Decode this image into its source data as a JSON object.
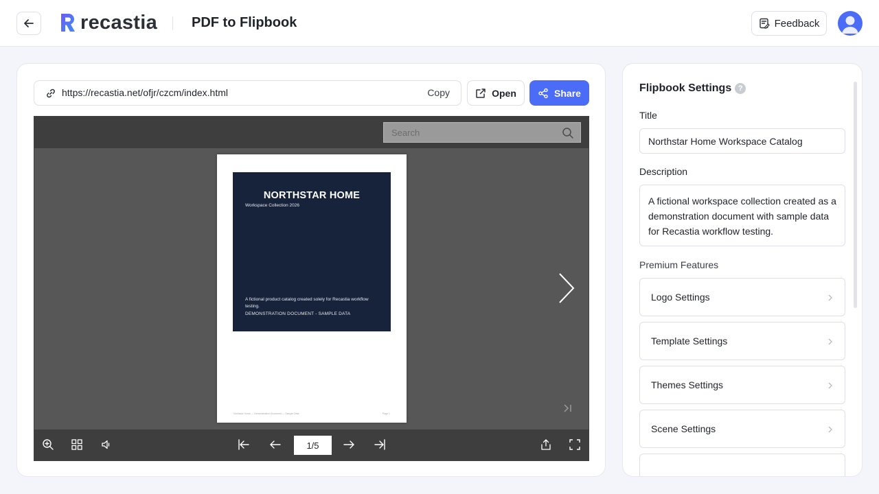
{
  "header": {
    "logo_text": "recastia",
    "page_title": "PDF to Flipbook",
    "feedback_label": "Feedback"
  },
  "link_bar": {
    "url": "https://recastia.net/ofjr/czcm/index.html",
    "copy_label": "Copy",
    "open_label": "Open",
    "share_label": "Share"
  },
  "viewer": {
    "search_placeholder": "Search",
    "page_indicator": "1/5",
    "cover": {
      "title": "NORTHSTAR HOME",
      "subtitle": "Workspace Collection 2026",
      "description": "A fictional product catalog created solely for Recastia workflow testing.",
      "note": "DEMONSTRATION DOCUMENT - SAMPLE DATA"
    },
    "footer_left": "Northstar Home — Demonstration Document — Sample Data",
    "footer_right": "Page 1"
  },
  "settings": {
    "heading": "Flipbook Settings",
    "title_label": "Title",
    "title_value": "Northstar Home Workspace Catalog",
    "description_label": "Description",
    "description_value": "A fictional workspace collection created as a demonstration document with sample data for Recastia workflow testing.",
    "premium_label": "Premium Features",
    "items": [
      {
        "label": "Logo Settings"
      },
      {
        "label": "Template Settings"
      },
      {
        "label": "Themes Settings"
      },
      {
        "label": "Scene Settings"
      }
    ]
  },
  "colors": {
    "brand_blue": "#4a6cf7",
    "cover_navy": "#17223b",
    "viewer_gray": "#575757"
  }
}
